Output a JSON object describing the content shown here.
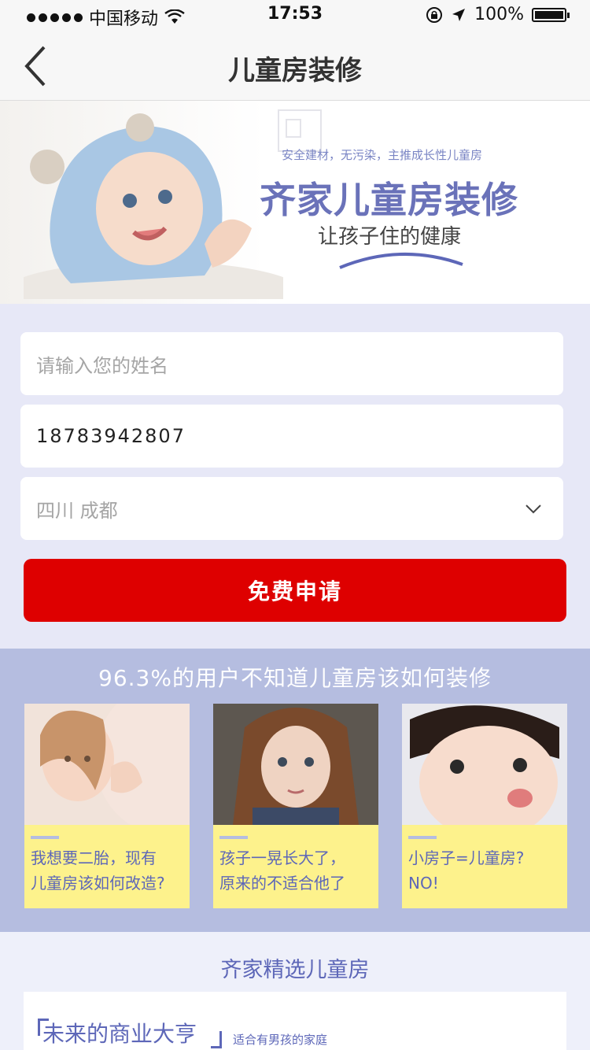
{
  "status_bar": {
    "carrier": "中国移动",
    "time": "17:53",
    "battery": "100%",
    "battery_level": 1.0
  },
  "nav": {
    "title": "儿童房装修"
  },
  "banner": {
    "subtitle": "安全建材，无污染，主推成长性儿童房",
    "headline": "齐家儿童房装修",
    "slogan": "让孩子住的健康"
  },
  "form": {
    "name_placeholder": "请输入您的姓名",
    "phone_value": "18783942807",
    "city_value": "四川 成都",
    "submit_label": "免费申请"
  },
  "stats": {
    "heading": "96.3%的用户不知道儿童房该如何装修",
    "cards": [
      {
        "line1": "我想要二胎，现有",
        "line2": "儿童房该如何改造?"
      },
      {
        "line1": "孩子一晃长大了，",
        "line2": "原来的不适合他了"
      },
      {
        "line1": "小房子=儿童房?",
        "line2": "NO!"
      }
    ]
  },
  "rooms": {
    "heading": "齐家精选儿童房",
    "panel_title": "未来的商业大亨",
    "panel_sub": "适合有男孩的家庭"
  },
  "colors": {
    "accent": "#6a72b9",
    "button": "#de0000",
    "card_bg": "#fdf28c",
    "section_bg": "#b5bde0"
  },
  "icons": [
    "back-chevron-icon",
    "wifi-icon",
    "location-arrow-icon",
    "lock-rotation-icon",
    "battery-icon",
    "dropdown-chevron-icon"
  ]
}
